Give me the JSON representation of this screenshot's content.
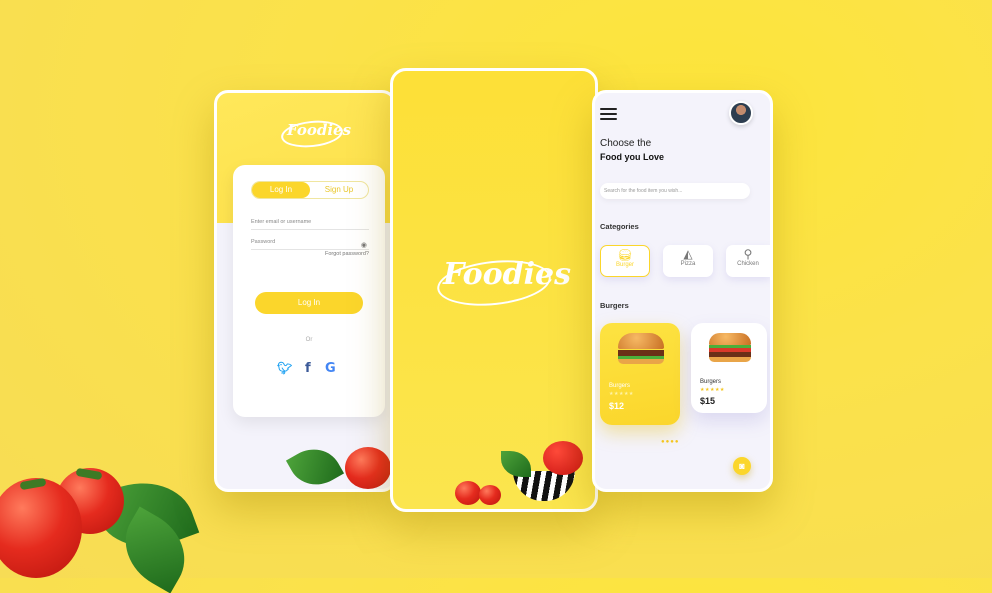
{
  "brand": {
    "logo_text": "Foodies",
    "accent": "#fbd62b",
    "background": "#fbe24a"
  },
  "login_screen": {
    "tabs": [
      {
        "label": "Log In",
        "active": true
      },
      {
        "label": "Sign Up",
        "active": false
      }
    ],
    "email_placeholder": "Enter email or username",
    "password_placeholder": "Password",
    "forgot_link": "Forgot password?",
    "login_button": "Log In",
    "or_text": "Or",
    "social_icons": [
      "twitter-icon",
      "facebook-icon",
      "google-icon"
    ]
  },
  "home_screen": {
    "greeting_line1": "Choose the",
    "greeting_line2": "Food you Love",
    "search_placeholder": "Search for the food item you wish...",
    "categories_heading": "Categories",
    "categories": [
      {
        "label": "Burger",
        "icon": "burger-icon",
        "active": true
      },
      {
        "label": "Pizza",
        "icon": "pizza-icon",
        "active": false
      },
      {
        "label": "Chicken",
        "icon": "chicken-icon",
        "active": false
      }
    ],
    "section_heading": "Burgers",
    "food_cards": [
      {
        "name": "Burgers",
        "stars": "★★★★★",
        "price": "$12"
      },
      {
        "name": "Burgers",
        "stars": "★★★★★",
        "price": "$15"
      }
    ],
    "pagination_dots": "●●●●"
  }
}
